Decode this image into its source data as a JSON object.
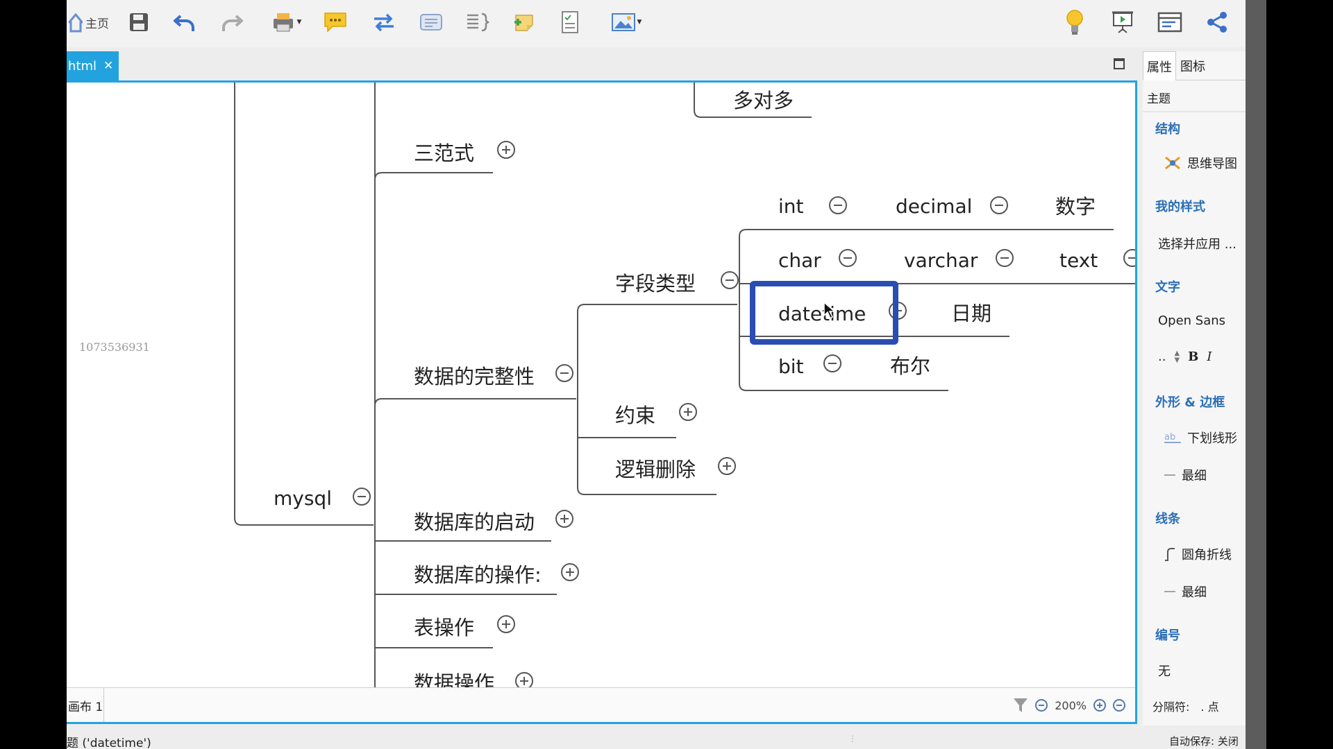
{
  "toolbar": {
    "home_label": "主页"
  },
  "tabs": {
    "doc_tab_label": "html",
    "close_glyph": "✕"
  },
  "canvas": {
    "watermark": "1073536931",
    "nodes": {
      "many_to_many": "多对多",
      "three_normal_forms": "三范式",
      "int": "int",
      "decimal": "decimal",
      "number": "数字",
      "char": "char",
      "varchar": "varchar",
      "text": "text",
      "field_types": "字段类型",
      "datetime": "datetime",
      "date": "日期",
      "bit": "bit",
      "boolean": "布尔",
      "data_integrity": "数据的完整性",
      "constraints": "约束",
      "logical_delete": "逻辑删除",
      "mysql": "mysql",
      "db_startup": "数据库的启动",
      "db_operations": "数据库的操作:",
      "table_operations": "表操作",
      "data_operations": "数据操作"
    },
    "sheet_tab": "画布 1",
    "zoom": "200%"
  },
  "statusbar": {
    "selection": "题 ('datetime')",
    "autosave": "自动保存: 关闭"
  },
  "panel": {
    "tab_properties": "属性",
    "tab_icons": "图标",
    "theme_label": "主题",
    "structure_title": "结构",
    "structure_value": "思维导图",
    "my_style_title": "我的样式",
    "my_style_value": "选择并应用 ...",
    "text_title": "文字",
    "font_name": "Open Sans",
    "font_size": "..",
    "bold": "B",
    "italic": "I",
    "shape_title": "外形 & 边框",
    "shape_value": "下划线形",
    "border_width": "最细",
    "line_title": "线条",
    "line_value": "圆角折线",
    "line_width": "最细",
    "numbering_title": "编号",
    "numbering_value": "无",
    "separator_label": "分隔符:",
    "separator_value": ". 点"
  }
}
